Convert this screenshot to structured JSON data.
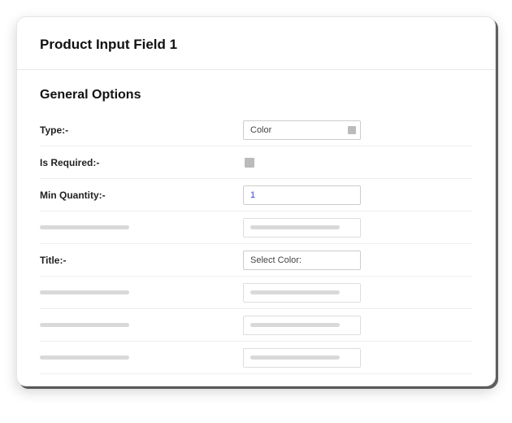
{
  "header": {
    "title": "Product Input Field 1"
  },
  "section": {
    "title": "General Options"
  },
  "fields": {
    "type": {
      "label": "Type:-",
      "value": "Color"
    },
    "isRequired": {
      "label": "Is Required:-",
      "checked": false
    },
    "minQuantity": {
      "label": "Min Quantity:-",
      "value": "1"
    },
    "title": {
      "label": "Title:-",
      "value": "Select Color:"
    }
  }
}
